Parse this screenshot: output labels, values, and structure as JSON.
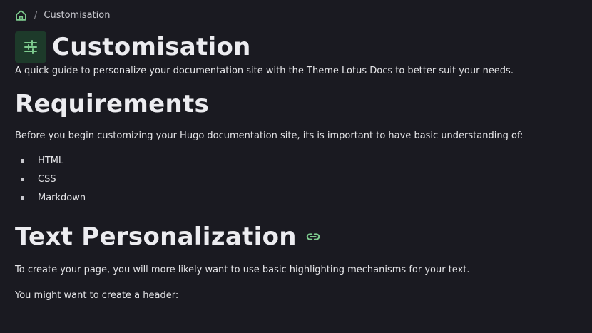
{
  "breadcrumb": {
    "separator": "/",
    "current": "Customisation"
  },
  "page": {
    "title": "Customisation",
    "title_icon": "sliders-icon",
    "lead": "A quick guide to personalize your documentation site with the Theme Lotus Docs to better suit your needs."
  },
  "requirements": {
    "heading": "Requirements",
    "intro": "Before you begin customizing your Hugo documentation site, its is important to have basic understanding of:",
    "items": [
      "HTML",
      "CSS",
      "Markdown"
    ]
  },
  "text_personalization": {
    "heading": "Text Personalization",
    "anchor_icon": "link-icon",
    "para1": "To create your page, you will more likely want to use basic highlighting mechanisms for your text.",
    "para2": "You might want to create a header:"
  },
  "colors": {
    "accent": "#7ecb8f",
    "background": "#1a1a21",
    "icon_bg": "#1d3a2a"
  }
}
